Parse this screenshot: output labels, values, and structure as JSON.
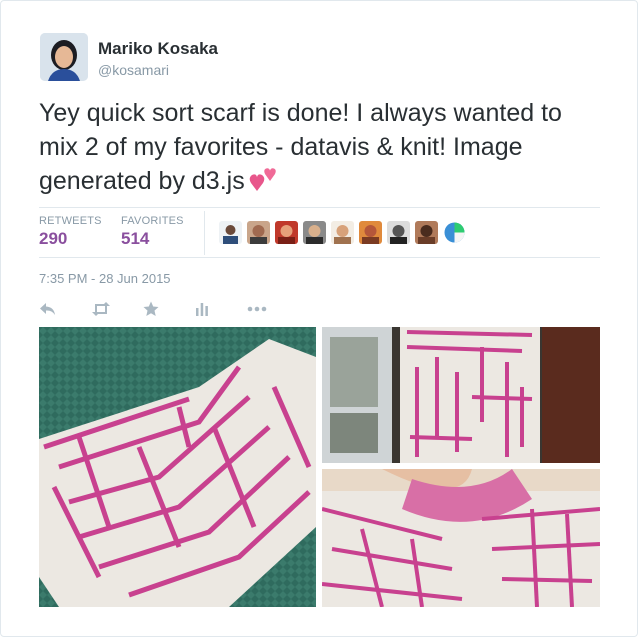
{
  "tweet": {
    "user": {
      "name": "Mariko Kosaka",
      "handle": "@kosamari"
    },
    "text": "Yey quick sort scarf is done!  I always wanted to mix 2 of my favorites - datavis & knit! Image generated by d3.js",
    "emoji_icon": "two-hearts-icon",
    "stats": {
      "retweets_label": "RETWEETS",
      "retweets_value": "290",
      "favorites_label": "FAVORITES",
      "favorites_value": "514"
    },
    "timestamp": "7:35 PM - 28 Jun 2015",
    "actions": [
      "reply-icon",
      "retweet-icon",
      "favorite-icon",
      "analytics-icon",
      "more-icon"
    ],
    "photo_count": 3
  },
  "colors": {
    "accent": "#8a4f9e",
    "text": "#292f33",
    "muted": "#8899a6",
    "border": "#e1e8ed",
    "scarf_pink": "#c8418f",
    "scarf_cream": "#ece8e2"
  }
}
